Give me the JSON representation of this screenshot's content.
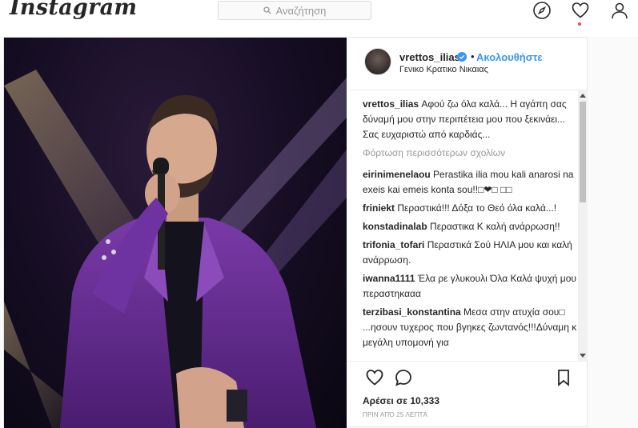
{
  "topbar": {
    "logo": "Instagram",
    "search_placeholder": "Αναζήτηση"
  },
  "post": {
    "username": "vrettos_ilias",
    "bullet": "•",
    "follow_label": "Ακολουθήστε",
    "location": "Γενικο Κρατικο Νικαιας",
    "caption": {
      "user": "vrettos_ilias",
      "text": "Αφού ζω όλα καλά... Η αγάπη σας δύναμή μου στην περιπέτεια μου που ξεκινάει... Σας ευχαριστώ από καρδιάς..."
    },
    "load_more": "Φόρτωση περισσότερων σχολίων",
    "comments": [
      {
        "user": "eirinimenelaou",
        "text": "Perastika ilia mou kali anarosi na exeis kai emeis konta sou!!□❤□ □□"
      },
      {
        "user": "friniekt",
        "text": "Περαστικά!!! Δόξα το Θεό όλα καλά...!"
      },
      {
        "user": "konstadinalab",
        "text": "Περαστικα Κ καλή ανάρρωση!!"
      },
      {
        "user": "trifonia_tofari",
        "text": "Περαστικά Σού ΗΛΙΑ μου και καλή ανάρρωση."
      },
      {
        "user": "iwanna1111",
        "text": "Έλα ρε γλυκουλι Όλα Καλά ψυχή μου περαστηκααα"
      },
      {
        "user": "terzibasi_konstantina",
        "text": "Μεσα στην ατυχία σου□ ...ησουν τυχερος που βγηκες ζωντανός!!!Δύναμη κ μεγάλη υπομονή για"
      }
    ],
    "likes": "Αρέσει σε 10,333",
    "time": "ΠΡΙΝ ΑΠΌ 25 ΛΕΠΤΆ"
  },
  "colors": {
    "accent": "#3897f0",
    "notification_dot": "#ed4956",
    "stage_purple": "#6a2f9e"
  },
  "icons": [
    "search-icon",
    "compass-icon",
    "heart-icon",
    "user-icon",
    "verified-icon",
    "comment-icon",
    "bookmark-icon"
  ]
}
